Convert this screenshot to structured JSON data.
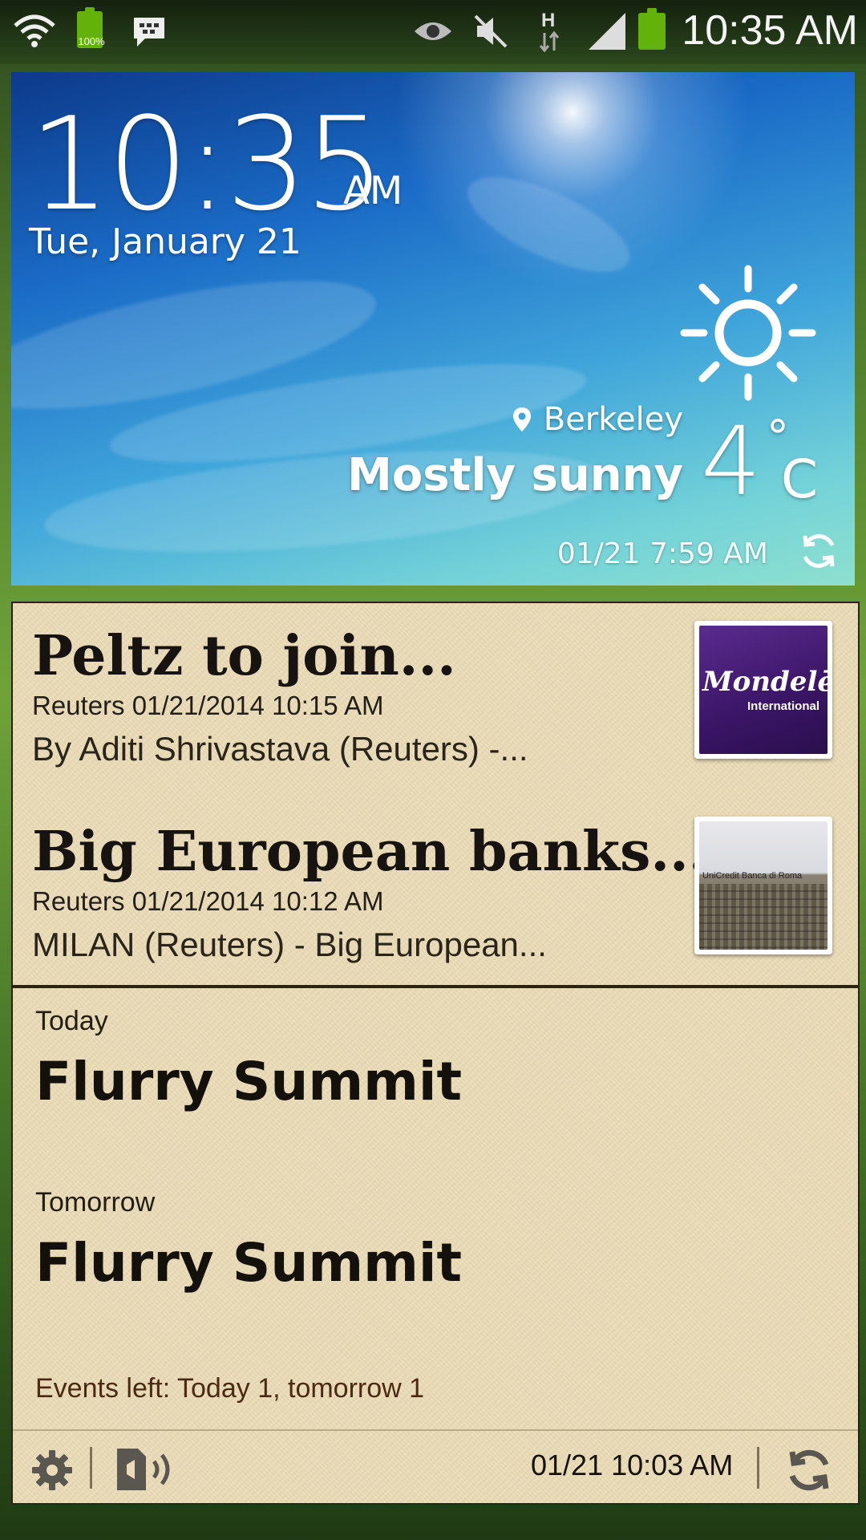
{
  "status_bar": {
    "battery_small_label": "100%",
    "time": "10:35 AM",
    "icons": [
      "wifi-icon",
      "battery-icon",
      "bbm-icon",
      "smart-stay-eye-icon",
      "mute-icon",
      "hspa-data-icon",
      "signal-icon",
      "battery-icon"
    ]
  },
  "weather_widget": {
    "time": "10:35",
    "ampm": "AM",
    "date": "Tue, January 21",
    "location": "Berkeley",
    "condition": "Mostly sunny",
    "temperature": "4",
    "degree_symbol": "°",
    "unit": "C",
    "updated": "01/21 7:59 AM",
    "colors": {
      "sky_top": "#0c3a8a",
      "sky_bottom": "#8ee0cf"
    }
  },
  "news": {
    "items": [
      {
        "title": "Peltz to join...",
        "meta": "Reuters 01/21/2014 10:15 AM",
        "snippet": "By Aditi Shrivastava (Reuters) -...",
        "thumb_logo": "Mondelēz",
        "thumb_sub": "International"
      },
      {
        "title": "Big European banks...",
        "meta": "Reuters 01/21/2014 10:12 AM",
        "snippet": "MILAN (Reuters) - Big European...",
        "thumb_sign": "UniCredit Banca di Roma"
      }
    ]
  },
  "calendar": {
    "days": [
      {
        "label": "Today",
        "event": "Flurry Summit"
      },
      {
        "label": "Tomorrow",
        "event": "Flurry Summit"
      }
    ],
    "summary": "Events left: Today 1, tomorrow 1",
    "footer_time": "01/21 10:03 AM",
    "colors": {
      "paper": "#ebdcb7",
      "summary_text": "#4a2a12"
    }
  }
}
